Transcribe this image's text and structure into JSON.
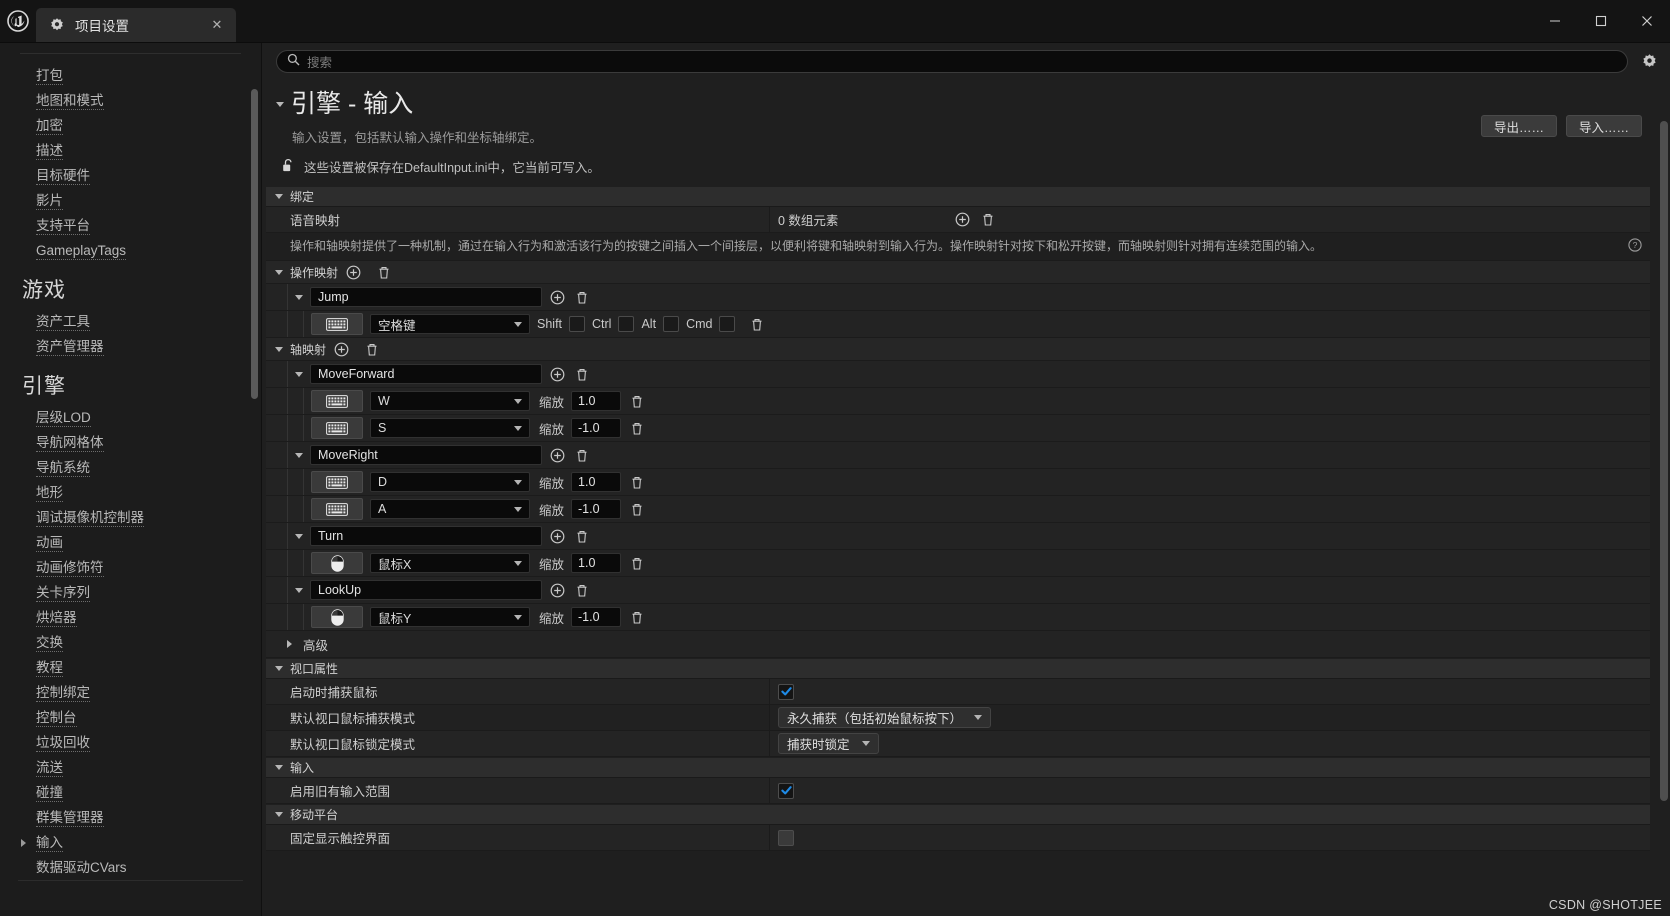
{
  "window": {
    "tab_title": "项目设置",
    "tab_icon": "settings-gear-icon",
    "close_label": "✕",
    "minimize_label": "—",
    "maximize_label": "▢",
    "window_close_label": "✕"
  },
  "sidebar": {
    "items": [
      {
        "label": "打包",
        "type": "link"
      },
      {
        "label": "地图和模式",
        "type": "link"
      },
      {
        "label": "加密",
        "type": "link"
      },
      {
        "label": "描述",
        "type": "link"
      },
      {
        "label": "目标硬件",
        "type": "link"
      },
      {
        "label": "影片",
        "type": "link"
      },
      {
        "label": "支持平台",
        "type": "link"
      },
      {
        "label": "GameplayTags",
        "type": "link"
      },
      {
        "label": "游戏",
        "type": "group"
      },
      {
        "label": "资产工具",
        "type": "link"
      },
      {
        "label": "资产管理器",
        "type": "link"
      },
      {
        "label": "引擎",
        "type": "group"
      },
      {
        "label": "层级LOD",
        "type": "link"
      },
      {
        "label": "导航网格体",
        "type": "link"
      },
      {
        "label": "导航系统",
        "type": "link"
      },
      {
        "label": "地形",
        "type": "link"
      },
      {
        "label": "调试摄像机控制器",
        "type": "link"
      },
      {
        "label": "动画",
        "type": "link"
      },
      {
        "label": "动画修饰符",
        "type": "link"
      },
      {
        "label": "关卡序列",
        "type": "link"
      },
      {
        "label": "烘焙器",
        "type": "link"
      },
      {
        "label": "交换",
        "type": "link"
      },
      {
        "label": "教程",
        "type": "link"
      },
      {
        "label": "控制绑定",
        "type": "link"
      },
      {
        "label": "控制台",
        "type": "link"
      },
      {
        "label": "垃圾回收",
        "type": "link"
      },
      {
        "label": "流送",
        "type": "link"
      },
      {
        "label": "碰撞",
        "type": "link"
      },
      {
        "label": "群集管理器",
        "type": "link"
      },
      {
        "label": "输入",
        "type": "link-expandable"
      },
      {
        "label": "数据驱动CVars",
        "type": "plain"
      }
    ]
  },
  "search": {
    "placeholder": "搜索",
    "icon": "search-icon",
    "settings_icon": "gear-icon"
  },
  "page": {
    "title": "引擎 - 输入",
    "subtitle": "输入设置，包括默认输入操作和坐标轴绑定。",
    "lock_notice": "这些设置被保存在DefaultInput.ini中，它当前可写入。",
    "lock_icon": "unlocked-padlock-icon",
    "export_button": "导出……",
    "import_button": "导入……"
  },
  "bindings": {
    "section_label": "绑定",
    "speech_mapping_label": "语音映射",
    "speech_mapping_value": "0 数组元素",
    "description": "操作和轴映射提供了一种机制，通过在输入行为和激活该行为的按键之间插入一个间接层，以便利将键和轴映射到输入行为。操作映射针对按下和松开按键，而轴映射则针对拥有连续范围的输入。",
    "action_mappings_label": "操作映射",
    "axis_mappings_label": "轴映射",
    "advanced_label": "高级",
    "scale_label": "缩放",
    "modifiers": [
      "Shift",
      "Ctrl",
      "Alt",
      "Cmd"
    ],
    "action_mappings": [
      {
        "name": "Jump",
        "keys": [
          {
            "device": "keyboard-icon",
            "key": "空格键",
            "shift": false,
            "ctrl": false,
            "alt": false,
            "cmd": false
          }
        ]
      }
    ],
    "axis_mappings": [
      {
        "name": "MoveForward",
        "keys": [
          {
            "device": "keyboard-icon",
            "key": "W",
            "scale": "1.0"
          },
          {
            "device": "keyboard-icon",
            "key": "S",
            "scale": "-1.0"
          }
        ]
      },
      {
        "name": "MoveRight",
        "keys": [
          {
            "device": "keyboard-icon",
            "key": "D",
            "scale": "1.0"
          },
          {
            "device": "keyboard-icon",
            "key": "A",
            "scale": "-1.0"
          }
        ]
      },
      {
        "name": "Turn",
        "keys": [
          {
            "device": "mouse-icon",
            "key": "鼠标X",
            "scale": "1.0"
          }
        ]
      },
      {
        "name": "LookUp",
        "keys": [
          {
            "device": "mouse-icon",
            "key": "鼠标Y",
            "scale": "-1.0"
          }
        ]
      }
    ]
  },
  "viewport": {
    "section_label": "视口属性",
    "rows": [
      {
        "label": "启动时捕获鼠标",
        "type": "checkbox",
        "checked": true
      },
      {
        "label": "默认视口鼠标捕获模式",
        "type": "combo",
        "value": "永久捕获（包括初始鼠标按下）"
      },
      {
        "label": "默认视口鼠标锁定模式",
        "type": "combo",
        "value": "捕获时锁定"
      }
    ]
  },
  "input_section": {
    "section_label": "输入",
    "rows": [
      {
        "label": "启用旧有输入范围",
        "type": "checkbox",
        "checked": true
      }
    ]
  },
  "mobile": {
    "section_label": "移动平台",
    "rows": [
      {
        "label": "固定显示触控界面",
        "type": "checkbox",
        "checked": false
      }
    ]
  },
  "watermark": "CSDN @SHOTJEE",
  "colors": {
    "accent_blue": "#1e8ae6",
    "panel_bg": "#1f1f1f",
    "row_bg": "#242424",
    "header_bg": "#2d2d2d"
  }
}
